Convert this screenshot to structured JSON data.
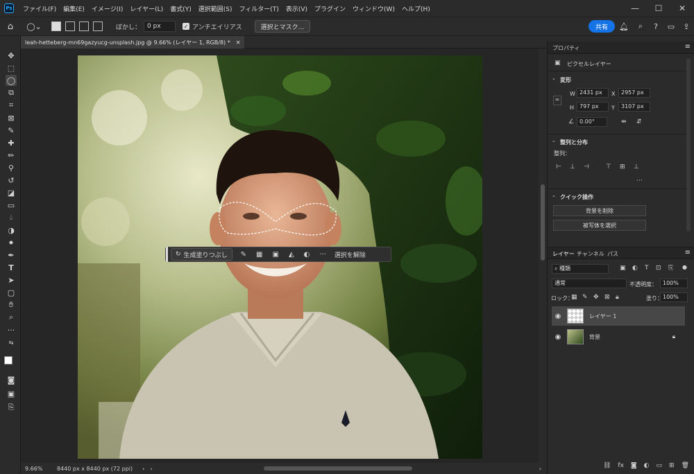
{
  "app": {
    "logo": "Ps"
  },
  "menu": [
    "ファイル(F)",
    "編集(E)",
    "イメージ(I)",
    "レイヤー(L)",
    "書式(Y)",
    "選択範囲(S)",
    "フィルター(T)",
    "表示(V)",
    "プラグイン",
    "ウィンドウ(W)",
    "ヘルプ(H)"
  ],
  "options": {
    "blur_label": "ぼかし：",
    "blur_value": "0 px",
    "antialias_label": "アンチエイリアス",
    "select_mask_label": "選択とマスク...",
    "share_label": "共有"
  },
  "document": {
    "tab_title": "leah-hetteberg-mn69gazyucg-unsplash.jpg @ 9.66% (レイヤー 1, RGB/8) *",
    "zoom": "9.66%",
    "size_info": "8440 px x 8440 px (72 ppi)"
  },
  "context_bar": {
    "generative_fill_label": "生成塗りつぶし",
    "deselect_label": "選択を解除",
    "more_label": "···"
  },
  "properties": {
    "tab_label": "プロパティ",
    "layer_type": "ピクセルレイヤー",
    "transform_title": "変形",
    "w_label": "W",
    "w_value": "2431 px",
    "x_label": "X",
    "x_value": "2957 px",
    "h_label": "H",
    "h_value": "797 px",
    "y_label": "Y",
    "y_value": "3107 px",
    "angle_value": "0.00°",
    "align_title": "整列と分布",
    "align_label": "整列：",
    "align_more": "···",
    "quick_title": "クイック操作",
    "remove_bg_label": "背景を削除",
    "select_subject_label": "被写体を選択"
  },
  "layers": {
    "tabs": [
      "レイヤー",
      "チャンネル",
      "パス"
    ],
    "filter_label": "種類",
    "blend_mode": "通常",
    "opacity_label": "不透明度：",
    "opacity_value": "100%",
    "lock_label": "ロック：",
    "fill_label": "塗り：",
    "fill_value": "100%",
    "items": [
      {
        "name": "レイヤー 1"
      },
      {
        "name": "背景"
      }
    ]
  },
  "colors": {
    "accent": "#1473e6",
    "panel": "#2b2b2b",
    "canvas": "#262626"
  }
}
